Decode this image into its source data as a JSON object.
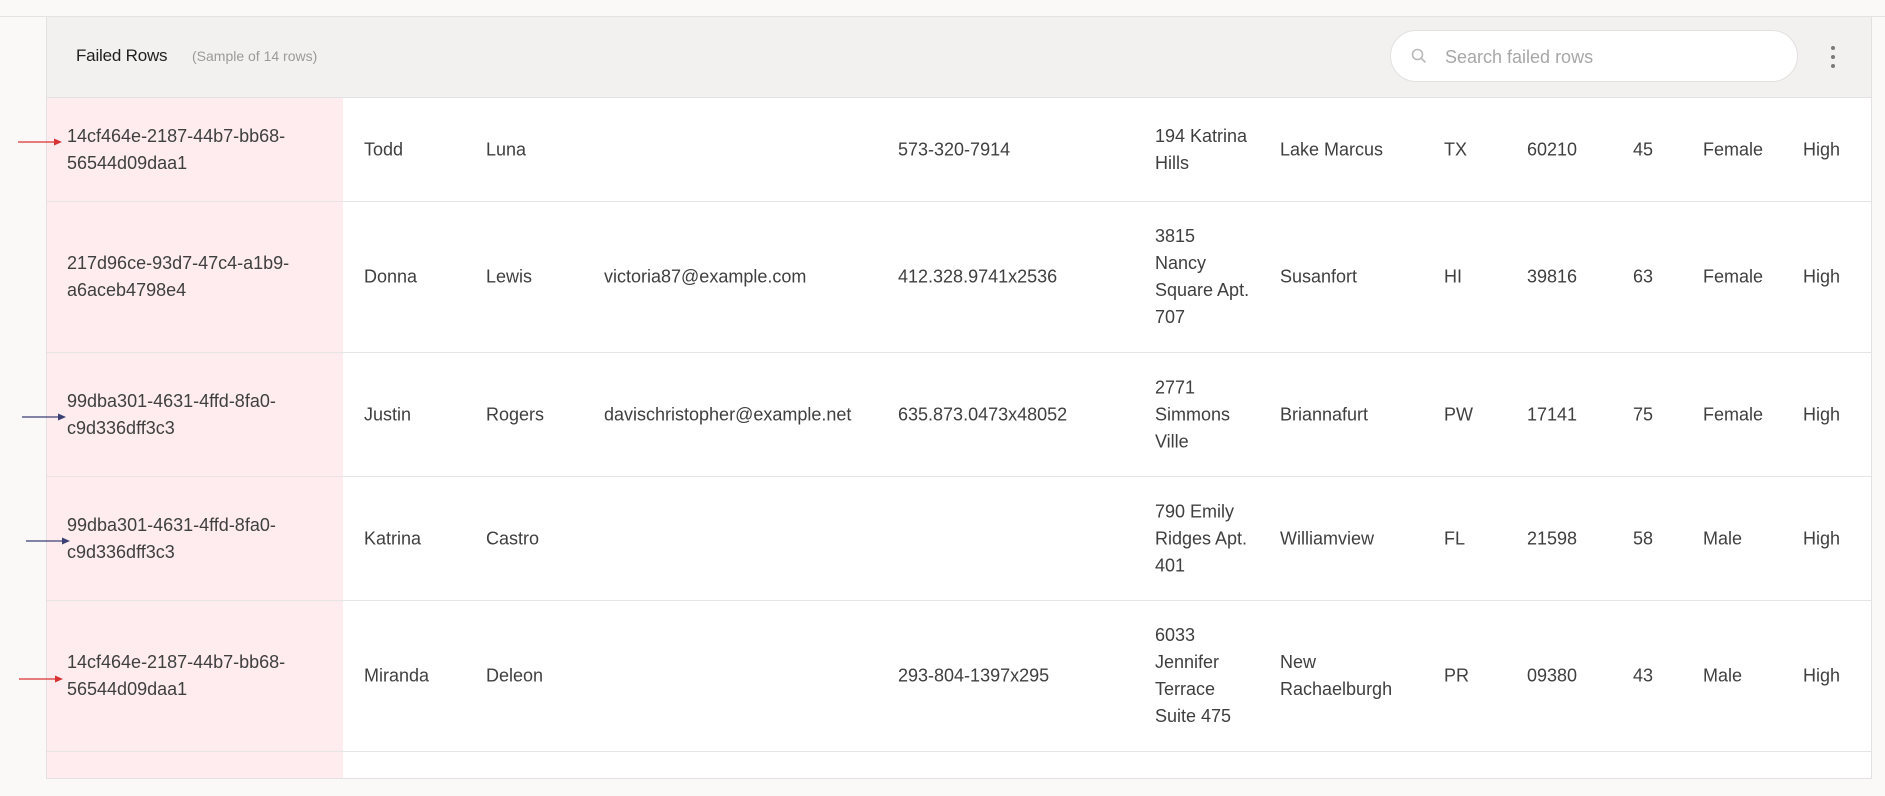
{
  "header": {
    "title": "Failed Rows",
    "subtitle": "(Sample of 14 rows)",
    "search_placeholder": "Search failed rows"
  },
  "colors": {
    "id_column_bg": "#feecee",
    "arrow_red": "#d93232",
    "arrow_navy": "#3b3f73"
  },
  "icons": {
    "search": "search-icon",
    "menu": "kebab-menu-icon",
    "row_marker": "arrow-right-icon"
  },
  "rows": [
    {
      "id": "14cf464e-2187-44b7-bb68-56544d09daa1",
      "first": "Todd",
      "last": "Luna",
      "email": "",
      "phone": "573-320-7914",
      "address": "194 Katrina Hills",
      "city": "Lake Marcus",
      "state": "TX",
      "zip": "60210",
      "age": "45",
      "gender": "Female",
      "risk": "High",
      "marker": "red"
    },
    {
      "id": "217d96ce-93d7-47c4-a1b9-a6aceb4798e4",
      "first": "Donna",
      "last": "Lewis",
      "email": "victoria87@example.com",
      "phone": "412.328.9741x2536",
      "address": "3815 Nancy Square Apt. 707",
      "city": "Susanfort",
      "state": "HI",
      "zip": "39816",
      "age": "63",
      "gender": "Female",
      "risk": "High",
      "marker": "none"
    },
    {
      "id": "99dba301-4631-4ffd-8fa0-c9d336dff3c3",
      "first": "Justin",
      "last": "Rogers",
      "email": "davischristopher@example.net",
      "phone": "635.873.0473x48052",
      "address": "2771 Simmons Ville",
      "city": "Briannafurt",
      "state": "PW",
      "zip": "17141",
      "age": "75",
      "gender": "Female",
      "risk": "High",
      "marker": "navy"
    },
    {
      "id": "99dba301-4631-4ffd-8fa0-c9d336dff3c3",
      "first": "Katrina",
      "last": "Castro",
      "email": "",
      "phone": "",
      "address": "790 Emily Ridges Apt. 401",
      "city": "Williamview",
      "state": "FL",
      "zip": "21598",
      "age": "58",
      "gender": "Male",
      "risk": "High",
      "marker": "navy"
    },
    {
      "id": "14cf464e-2187-44b7-bb68-56544d09daa1",
      "first": "Miranda",
      "last": "Deleon",
      "email": "",
      "phone": "293-804-1397x295",
      "address": "6033 Jennifer Terrace Suite 475",
      "city": "New Rachaelburgh",
      "state": "PR",
      "zip": "09380",
      "age": "43",
      "gender": "Male",
      "risk": "High",
      "marker": "red"
    }
  ]
}
